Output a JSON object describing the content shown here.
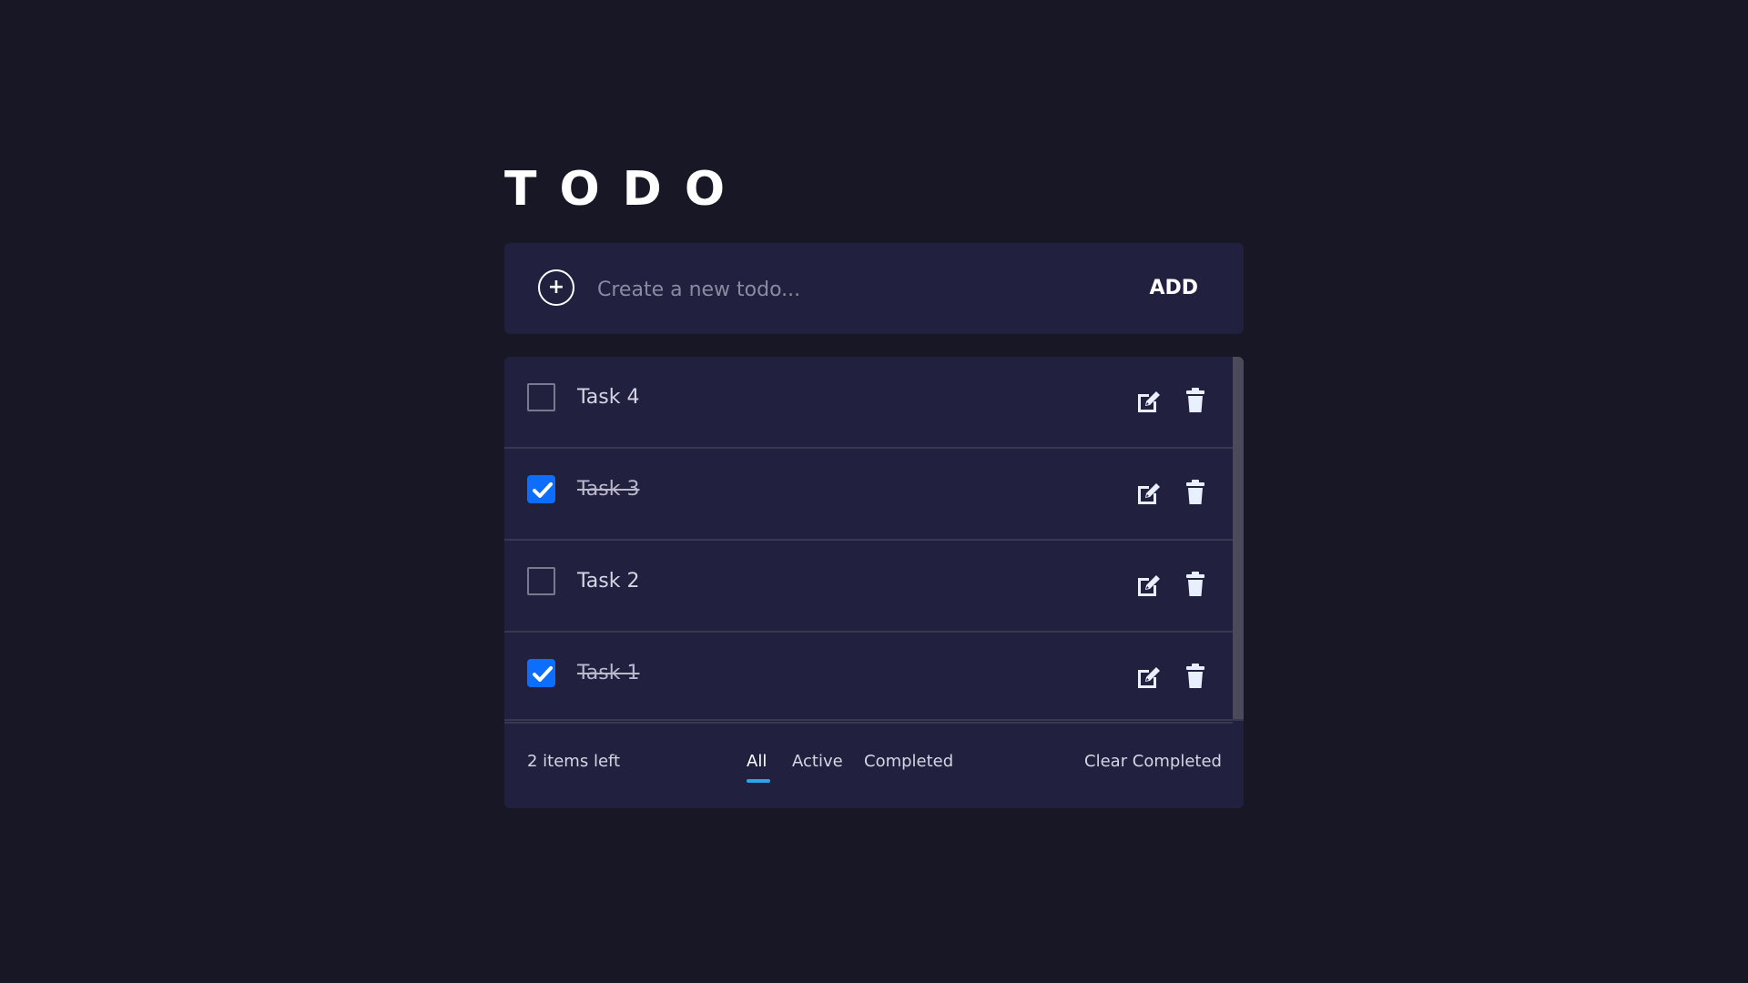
{
  "header": {
    "title": "TODO"
  },
  "new_todo": {
    "placeholder": "Create a new todo...",
    "value": "",
    "add_icon": "plus-circle-icon",
    "add_label": "ADD"
  },
  "todos": [
    {
      "label": "Task 4",
      "completed": false
    },
    {
      "label": "Task 3",
      "completed": true
    },
    {
      "label": "Task 2",
      "completed": false
    },
    {
      "label": "Task 1",
      "completed": true
    }
  ],
  "footer": {
    "items_left": "2 items left",
    "filters": [
      {
        "label": "All",
        "active": true
      },
      {
        "label": "Active",
        "active": false
      },
      {
        "label": "Completed",
        "active": false
      }
    ],
    "clear_label": "Clear Completed"
  },
  "icons": {
    "edit": "edit-icon",
    "delete": "trash-icon"
  },
  "colors": {
    "background": "#181726",
    "card": "#21203f",
    "accent": "#0d6efd",
    "filter_underline": "#2aa5e8"
  }
}
